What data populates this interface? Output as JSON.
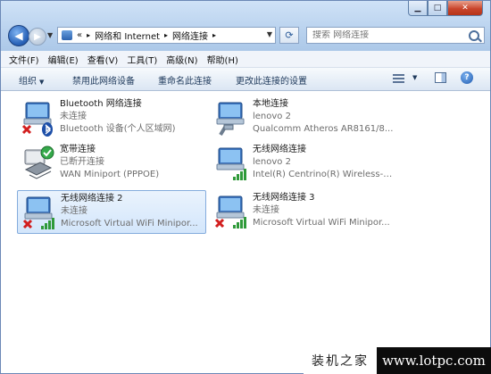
{
  "window": {
    "caption_buttons": [
      "minimize-icon",
      "maximize-icon",
      "close-icon"
    ]
  },
  "nav": {
    "back_icon": "back-arrow-icon",
    "forward_icon": "forward-arrow-icon",
    "breadcrumb_prefix": "«",
    "breadcrumb": [
      "网络和 Internet",
      "网络连接"
    ],
    "separator": "▸",
    "refresh_icon": "refresh-icon",
    "search_placeholder": "搜索 网络连接"
  },
  "menu": {
    "items": [
      "文件(F)",
      "编辑(E)",
      "查看(V)",
      "工具(T)",
      "高级(N)",
      "帮助(H)"
    ]
  },
  "toolbar": {
    "organize": "组织",
    "disable": "禁用此网络设备",
    "rename": "重命名此连接",
    "change_settings": "更改此连接的设置",
    "help_label": "?"
  },
  "connections": [
    {
      "name": "Bluetooth 网络连接",
      "status": "未连接",
      "device": "Bluetooth 设备(个人区域网)",
      "icon": "bluetooth-adapter-icon",
      "badge": "disconnected-x-icon",
      "selected": false
    },
    {
      "name": "本地连接",
      "status": "lenovo  2",
      "device": "Qualcomm Atheros AR8161/8...",
      "icon": "ethernet-adapter-icon",
      "badge": "cable-icon",
      "selected": false
    },
    {
      "name": "宽带连接",
      "status": "已断开连接",
      "device": "WAN Miniport (PPPOE)",
      "icon": "broadband-modem-icon",
      "badge": "check-icon",
      "selected": false
    },
    {
      "name": "无线网络连接",
      "status": "lenovo  2",
      "device": "Intel(R) Centrino(R) Wireless-N...",
      "icon": "wireless-adapter-icon",
      "badge": "signal-bars-icon",
      "selected": false
    },
    {
      "name": "无线网络连接 2",
      "status": "未连接",
      "device": "Microsoft Virtual WiFi Minipor...",
      "icon": "wireless-adapter-icon",
      "badge": "disconnected-x-icon",
      "selected": true
    },
    {
      "name": "无线网络连接 3",
      "status": "未连接",
      "device": "Microsoft Virtual WiFi Minipor...",
      "icon": "wireless-adapter-icon",
      "badge": "disconnected-x-icon",
      "selected": false
    }
  ],
  "watermark": {
    "left": "装机之家",
    "right": "www.lotpc.com"
  },
  "colors": {
    "selection": "#d3e6fb",
    "titlebar": "#b9d2ee",
    "link_text": "#1e395b",
    "close_button": "#c9452c"
  }
}
